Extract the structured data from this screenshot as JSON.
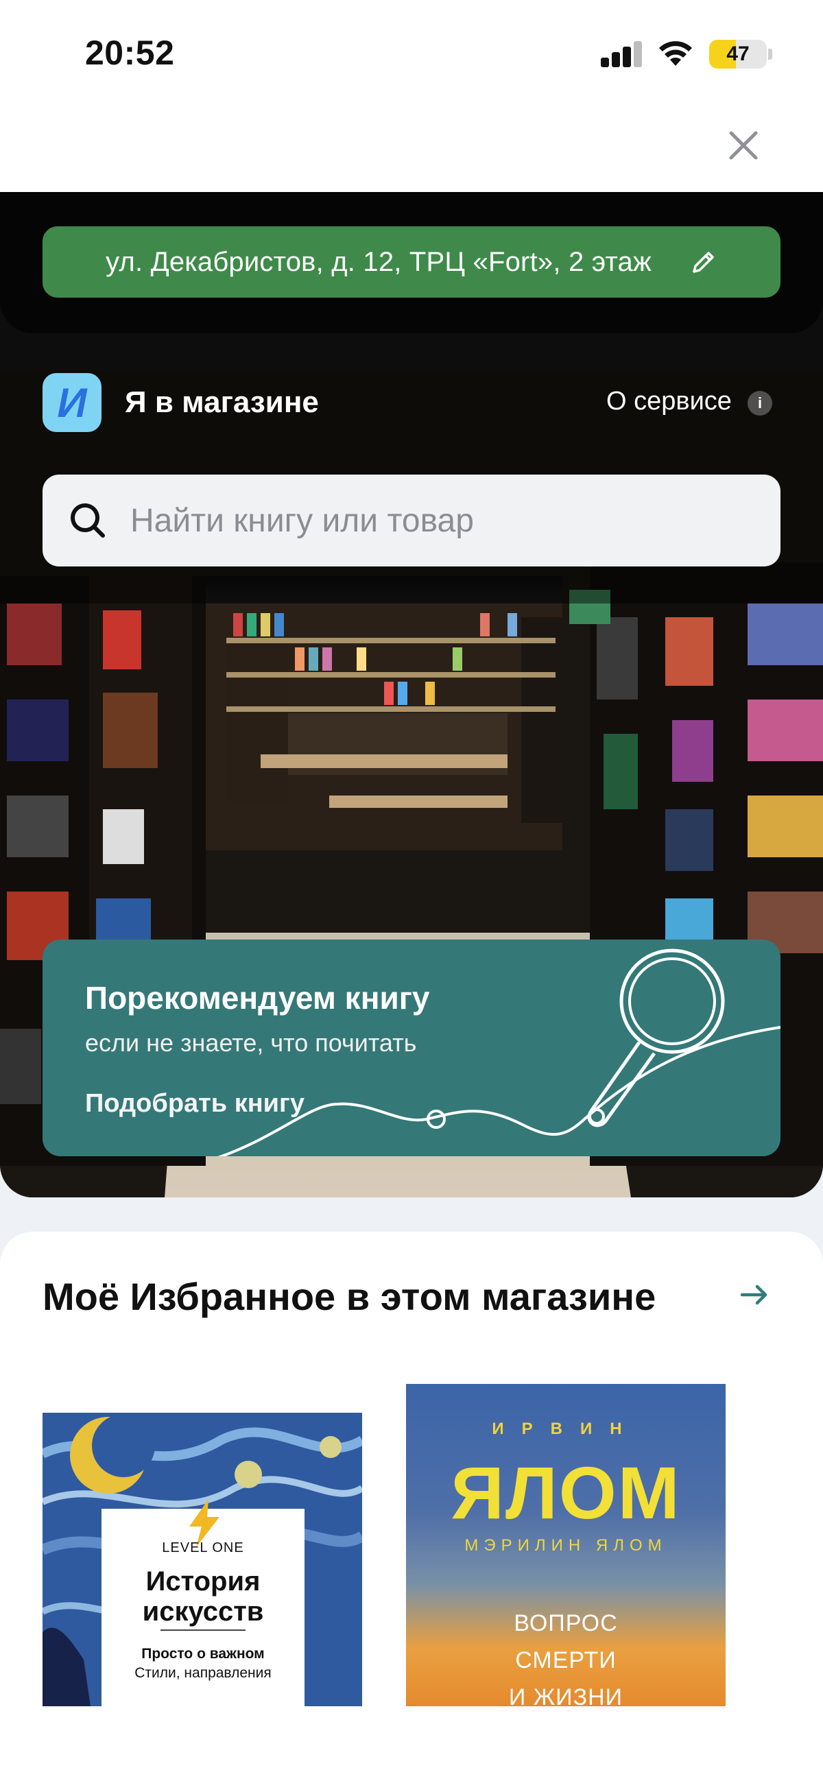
{
  "status_bar": {
    "time": "20:52",
    "battery_level": "47",
    "battery_fraction": 0.47
  },
  "address": {
    "text": "ул. Декабристов, д. 12, ТРЦ «Fort», 2 этаж"
  },
  "store": {
    "logo_letter": "И",
    "title": "Я в магазине",
    "about_label": "О сервисе",
    "info_glyph": "i"
  },
  "search": {
    "placeholder": "Найти книгу или товар"
  },
  "promo": {
    "title": "Порекомендуем книгу",
    "subtitle": "если не знаете, что почитать",
    "link": "Подобрать книгу"
  },
  "favorites": {
    "title": "Моё Избранное в этом магазине",
    "books": [
      {
        "level": "LEVEL ONE",
        "title_line1": "История",
        "title_line2": "искусств",
        "subtitle": "Просто о важном",
        "subtitle2": "Стили, направления"
      },
      {
        "author": "ИРВИН",
        "title": "ЯЛОМ",
        "coauthor": "МЭРИЛИН ЯЛОМ",
        "line1": "ВОПРОС",
        "line2": "СМЕРТИ",
        "line3": "И ЖИЗНИ"
      }
    ]
  },
  "colors": {
    "address_green": "#3f8a4a",
    "promo_teal": "#357878",
    "logo_blue": "#7fd4f4",
    "accent_teal": "#2f7d7d"
  },
  "icons": [
    "close-icon",
    "pencil-icon",
    "search-icon",
    "info-icon",
    "arrow-right-icon",
    "signal-icon",
    "wifi-icon",
    "battery-icon",
    "magnifier-illustration"
  ]
}
